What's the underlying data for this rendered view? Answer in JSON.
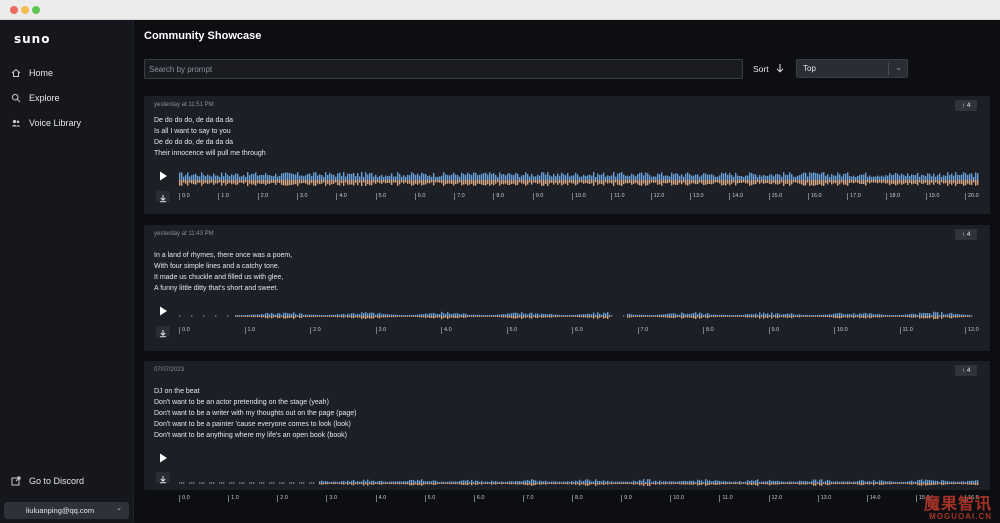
{
  "window": {
    "dots": [
      "#ed6a5e",
      "#f5bf4f",
      "#61c554"
    ]
  },
  "sidebar": {
    "logo": "suno",
    "items": [
      {
        "label": "Home",
        "icon": "home-icon"
      },
      {
        "label": "Explore",
        "icon": "search-icon"
      },
      {
        "label": "Voice Library",
        "icon": "users-icon"
      }
    ],
    "discord_label": "Go to Discord",
    "account_email": "liuluanping@qq.com"
  },
  "main": {
    "title": "Community Showcase",
    "search_placeholder": "Search by prompt",
    "sort_label": "Sort",
    "sort_value": "Top"
  },
  "colors": {
    "wave_blue": "#6aa0d8",
    "wave_orange": "#d8a884"
  },
  "songs": [
    {
      "time": "yesterday at 11:51 PM",
      "lyrics": [
        "De do do do, de da da da",
        "Is all I want to say to you",
        "De do do do, de da da da",
        "Their innocence will pull me through"
      ],
      "votes": "4",
      "ticks": [
        "0.0",
        "1.0",
        "2.0",
        "3.0",
        "4.0",
        "5.0",
        "6.0",
        "7.0",
        "8.0",
        "9.0",
        "10.0",
        "11.0",
        "12.0",
        "13.0",
        "14.0",
        "15.0",
        "16.0",
        "17.0",
        "18.0",
        "19.0",
        "20.0"
      ]
    },
    {
      "time": "yesterday at 11:43 PM",
      "lyrics": [
        "In a land of rhymes, there once was a poem,",
        "With four simple lines and a catchy tone.",
        "It made us chuckle and filled us with glee,",
        "A funny little ditty that's short and sweet."
      ],
      "votes": "4",
      "ticks": [
        "0.0",
        "1.0",
        "2.0",
        "3.0",
        "4.0",
        "5.0",
        "6.0",
        "7.0",
        "8.0",
        "9.0",
        "10.0",
        "11.0",
        "12.0"
      ]
    },
    {
      "time": "07/07/2023",
      "lyrics": [
        "DJ on the beat",
        "Don't want to be an actor pretending on the stage (yeah)",
        "Don't want to be a writer with my thoughts out on the page (page)",
        "Don't want to be a painter 'cause everyone comes to look (look)",
        "Don't want to be anything where my life's an open book (book)"
      ],
      "votes": "4",
      "ticks": [
        "0.0",
        "1.0",
        "2.0",
        "3.0",
        "4.0",
        "5.0",
        "6.0",
        "7.0",
        "8.0",
        "9.0",
        "10.0",
        "11.0",
        "12.0",
        "13.0",
        "14.0",
        "15.0",
        "16.0"
      ]
    }
  ],
  "watermark": {
    "line1": "魔果智讯",
    "line2": "MOGUOAI.CN"
  }
}
